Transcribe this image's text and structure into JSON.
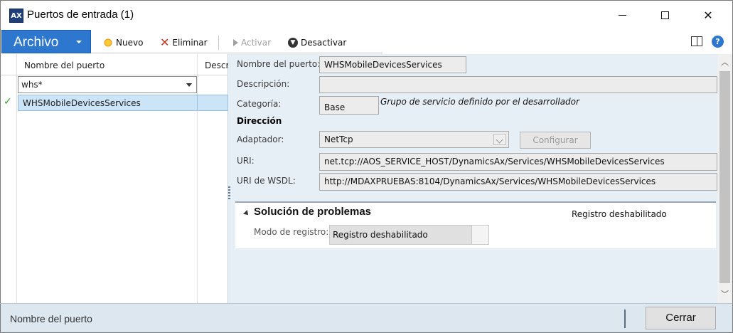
{
  "window": {
    "title": "Puertos de entrada (1)",
    "app_icon_text": "AX"
  },
  "ribbon": {
    "file_label": "Archivo",
    "new_label": "Nuevo",
    "delete_label": "Eliminar",
    "activate_label": "Activar",
    "deactivate_label": "Desactivar"
  },
  "grid": {
    "columns": [
      "Nombre del puerto",
      "Descr"
    ],
    "filter_value": "whs*",
    "rows": [
      {
        "name": "WHSMobileDevicesServices",
        "selected": true
      }
    ]
  },
  "detail": {
    "port_name_label": "Nombre del puerto:",
    "port_name_value": "WHSMobileDevicesServices",
    "description_label": "Descripción:",
    "description_value": "",
    "category_label": "Categoría:",
    "category_value": "Base",
    "category_note": "Grupo de servicio definido por el desarrollador",
    "address_heading": "Dirección",
    "adapter_label": "Adaptador:",
    "adapter_value": "NetTcp",
    "configure_label": "Configurar",
    "uri_label": "URI:",
    "uri_value": "net.tcp://AOS_SERVICE_HOST/DynamicsAx/Services/WHSMobileDevicesServices",
    "wsdl_label": "URI de WSDL:",
    "wsdl_value": "http://MDAXPRUEBAS:8104/DynamicsAx/Services/WHSMobileDevicesServices"
  },
  "troubleshooting": {
    "title": "Solución de problemas",
    "summary": "Registro deshabilitado",
    "log_mode_label": "Modo de registro:",
    "log_mode_value": "Registro deshabilitado"
  },
  "status": {
    "text": "Nombre del puerto",
    "close_label": "Cerrar"
  }
}
